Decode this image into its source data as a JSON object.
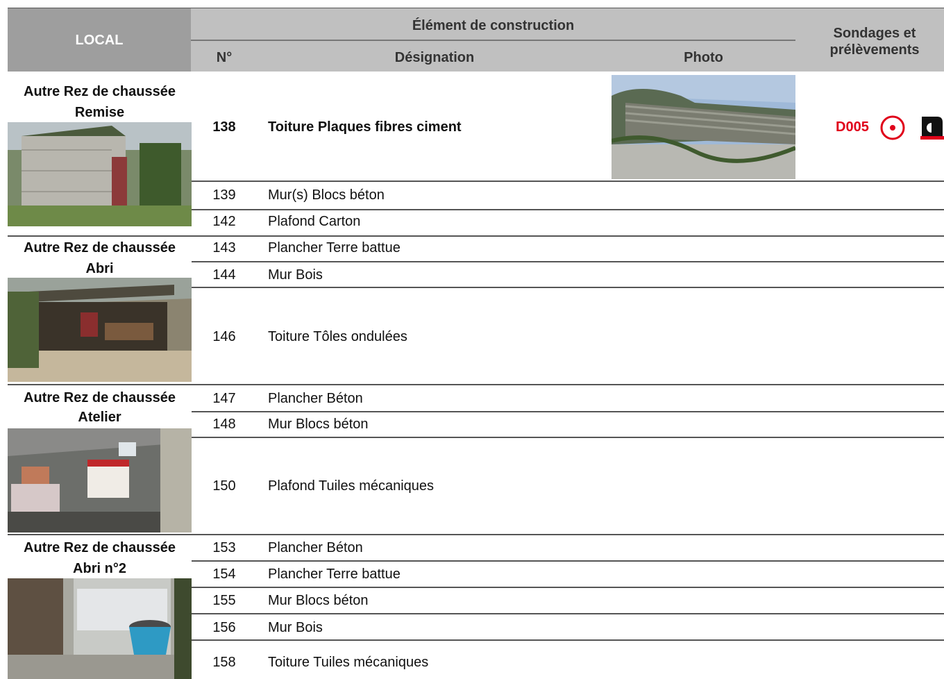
{
  "header": {
    "local": "LOCAL",
    "element": "Élément de construction",
    "num": "N°",
    "designation": "Désignation",
    "photo": "Photo",
    "sondages": "Sondages et prélèvements"
  },
  "locals": [
    {
      "title1": "Autre Rez de chaussée",
      "title2": "Remise"
    },
    {
      "title1": "Autre Rez de chaussée",
      "title2": "Abri"
    },
    {
      "title1": "Autre Rez de chaussée",
      "title2": "Atelier"
    },
    {
      "title1": "Autre Rez de chaussée",
      "title2": "Abri n°2"
    }
  ],
  "rows": [
    {
      "num": "138",
      "designation": "Toiture Plaques fibres ciment"
    },
    {
      "num": "139",
      "designation": "Mur(s) Blocs béton"
    },
    {
      "num": "142",
      "designation": "Plafond Carton"
    },
    {
      "num": "143",
      "designation": "Plancher Terre battue"
    },
    {
      "num": "144",
      "designation": "Mur Bois"
    },
    {
      "num": "146",
      "designation": "Toiture Tôles ondulées"
    },
    {
      "num": "147",
      "designation": "Plancher Béton"
    },
    {
      "num": "148",
      "designation": "Mur Blocs béton"
    },
    {
      "num": "150",
      "designation": "Plafond Tuiles mécaniques"
    },
    {
      "num": "153",
      "designation": "Plancher Béton"
    },
    {
      "num": "154",
      "designation": "Plancher Terre battue"
    },
    {
      "num": "155",
      "designation": "Mur Blocs béton"
    },
    {
      "num": "156",
      "designation": "Mur Bois"
    },
    {
      "num": "158",
      "designation": "Toiture Tuiles mécaniques"
    }
  ],
  "sondage": {
    "code": "D005",
    "color": "#e0001a"
  }
}
